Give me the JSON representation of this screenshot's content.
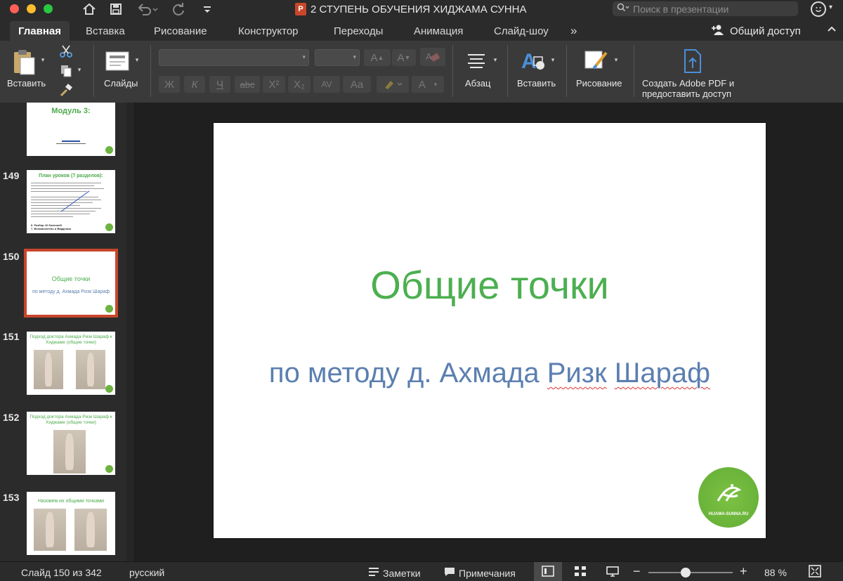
{
  "titlebar": {
    "title": "2 СТУПЕНЬ ОБУЧЕНИЯ ХИДЖАМА СУННА",
    "app_badge": "P",
    "search_placeholder": "Поиск в презентации"
  },
  "tabs": [
    {
      "label": "Главная",
      "active": true
    },
    {
      "label": "Вставка"
    },
    {
      "label": "Рисование"
    },
    {
      "label": "Конструктор"
    },
    {
      "label": "Переходы"
    },
    {
      "label": "Анимация"
    },
    {
      "label": "Слайд-шоу"
    }
  ],
  "tabs_more": "»",
  "share_label": "Общий доступ",
  "ribbon": {
    "paste_label": "Вставить",
    "slides_label": "Слайды",
    "paragraph_label": "Абзац",
    "insert_label": "Вставить",
    "drawing_label": "Рисование",
    "adobe_label_line1": "Создать Adobe PDF и",
    "adobe_label_line2": "предоставить доступ",
    "bold": "Ж",
    "italic": "К",
    "underline": "Ч",
    "strike": "abc",
    "superscript": "X²",
    "subscript": "X₂",
    "spacing": "AV",
    "change_case": "Aa",
    "font_color": "A",
    "grow": "A",
    "shrink": "A"
  },
  "thumbnails": [
    {
      "num": "",
      "title": "Модуль 3:",
      "kind": "module"
    },
    {
      "num": "149",
      "title": "План уроков (7 разделов):",
      "kind": "plan",
      "footer1": "6. Разбор 10 болезней",
      "footer2": "7. Вспомогатель и Вардения"
    },
    {
      "num": "150",
      "title": "Общие точки",
      "subtitle": "по методу д. Ахмада Ризк Шараф",
      "kind": "title",
      "selected": true
    },
    {
      "num": "151",
      "title": "Подход доктора Ахмада Ризк Шараф к Хиджаме (общие точки)",
      "kind": "two"
    },
    {
      "num": "152",
      "title": "Подход доктора Ахмада Ризк Шараф к Хиджаме (общие точки)",
      "kind": "one"
    },
    {
      "num": "153",
      "title": "Назовем их общими точками",
      "kind": "two"
    }
  ],
  "slide": {
    "title": "Общие точки",
    "subtitle_part1": "по методу д. Ахмада ",
    "subtitle_part2": "Ризк",
    "subtitle_part3": " ",
    "subtitle_part4": "Шараф",
    "logo_text": "HIJAMA-SUNNA.RU"
  },
  "statusbar": {
    "slide_info": "Слайд 150 из 342",
    "language": "русский",
    "notes_label": "Заметки",
    "comments_label": "Примечания",
    "zoom": "88 %",
    "zoom_fraction": 0.44
  }
}
